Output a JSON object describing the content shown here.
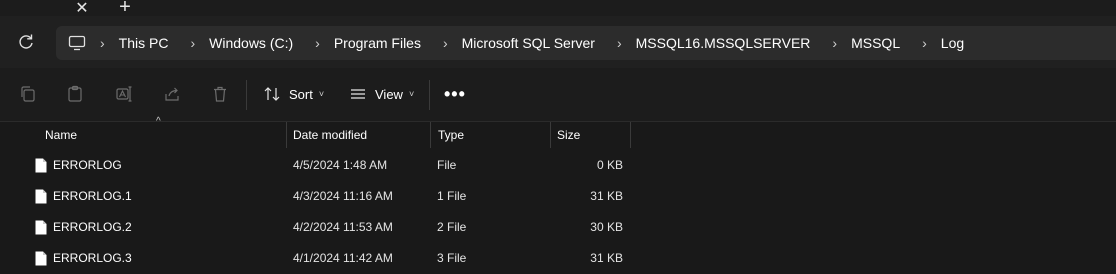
{
  "tabstrip": {
    "close_glyph": "✕",
    "add_glyph": "+"
  },
  "address": {
    "crumbs": [
      "This PC",
      "Windows (C:)",
      "Program Files",
      "Microsoft SQL Server",
      "MSSQL16.MSSQLSERVER",
      "MSSQL",
      "Log"
    ],
    "separator": "›"
  },
  "toolbar": {
    "sort_label": "Sort",
    "view_label": "View",
    "more_label": "•••",
    "caret": "˅"
  },
  "list": {
    "columns": [
      "Name",
      "Date modified",
      "Type",
      "Size"
    ],
    "sort_caret": "^",
    "rows": [
      {
        "name": "ERRORLOG",
        "date": "4/5/2024 1:48 AM",
        "type": "File",
        "size": "0 KB"
      },
      {
        "name": "ERRORLOG.1",
        "date": "4/3/2024 11:16 AM",
        "type": "1 File",
        "size": "31 KB"
      },
      {
        "name": "ERRORLOG.2",
        "date": "4/2/2024 11:53 AM",
        "type": "2 File",
        "size": "30 KB"
      },
      {
        "name": "ERRORLOG.3",
        "date": "4/1/2024 11:42 AM",
        "type": "3 File",
        "size": "31 KB"
      }
    ]
  }
}
